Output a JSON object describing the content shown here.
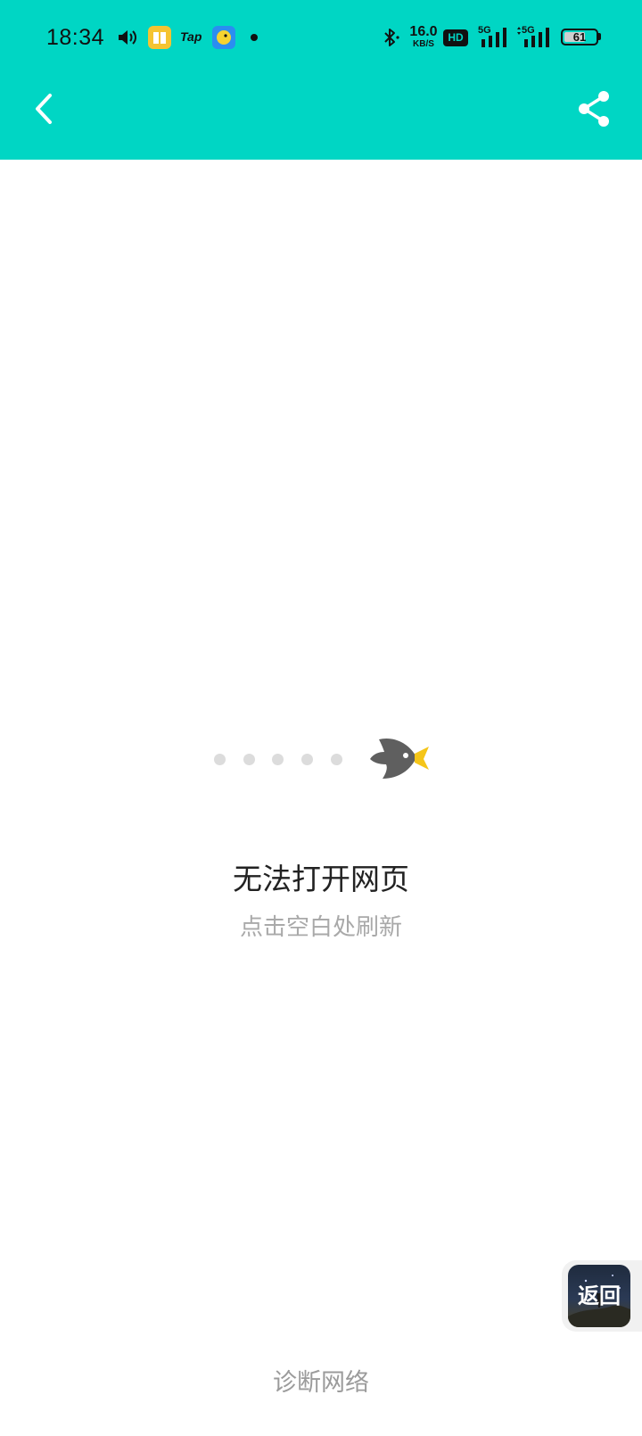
{
  "status_bar": {
    "time": "18:34",
    "net_speed_value": "16.0",
    "net_speed_unit": "KB/S",
    "hd_badge": "HD",
    "signal1_label": "5G",
    "signal2_label": "5G",
    "battery_level": "61",
    "tap_label": "Tap",
    "icons": [
      "volume-icon",
      "book-app-icon",
      "tap-app-icon",
      "bird-app-icon",
      "dot-icon",
      "bluetooth-icon",
      "hd-icon",
      "signal-icon",
      "signal-icon",
      "battery-icon"
    ]
  },
  "header": {
    "background": "#00d6c4",
    "back_icon": "chevron-left-icon",
    "share_icon": "share-icon"
  },
  "error": {
    "title": "无法打开网页",
    "subtitle": "点击空白处刷新",
    "illustration": "bird-icon"
  },
  "floating_back": {
    "label": "返回"
  },
  "footer": {
    "diagnose_label": "诊断网络"
  }
}
